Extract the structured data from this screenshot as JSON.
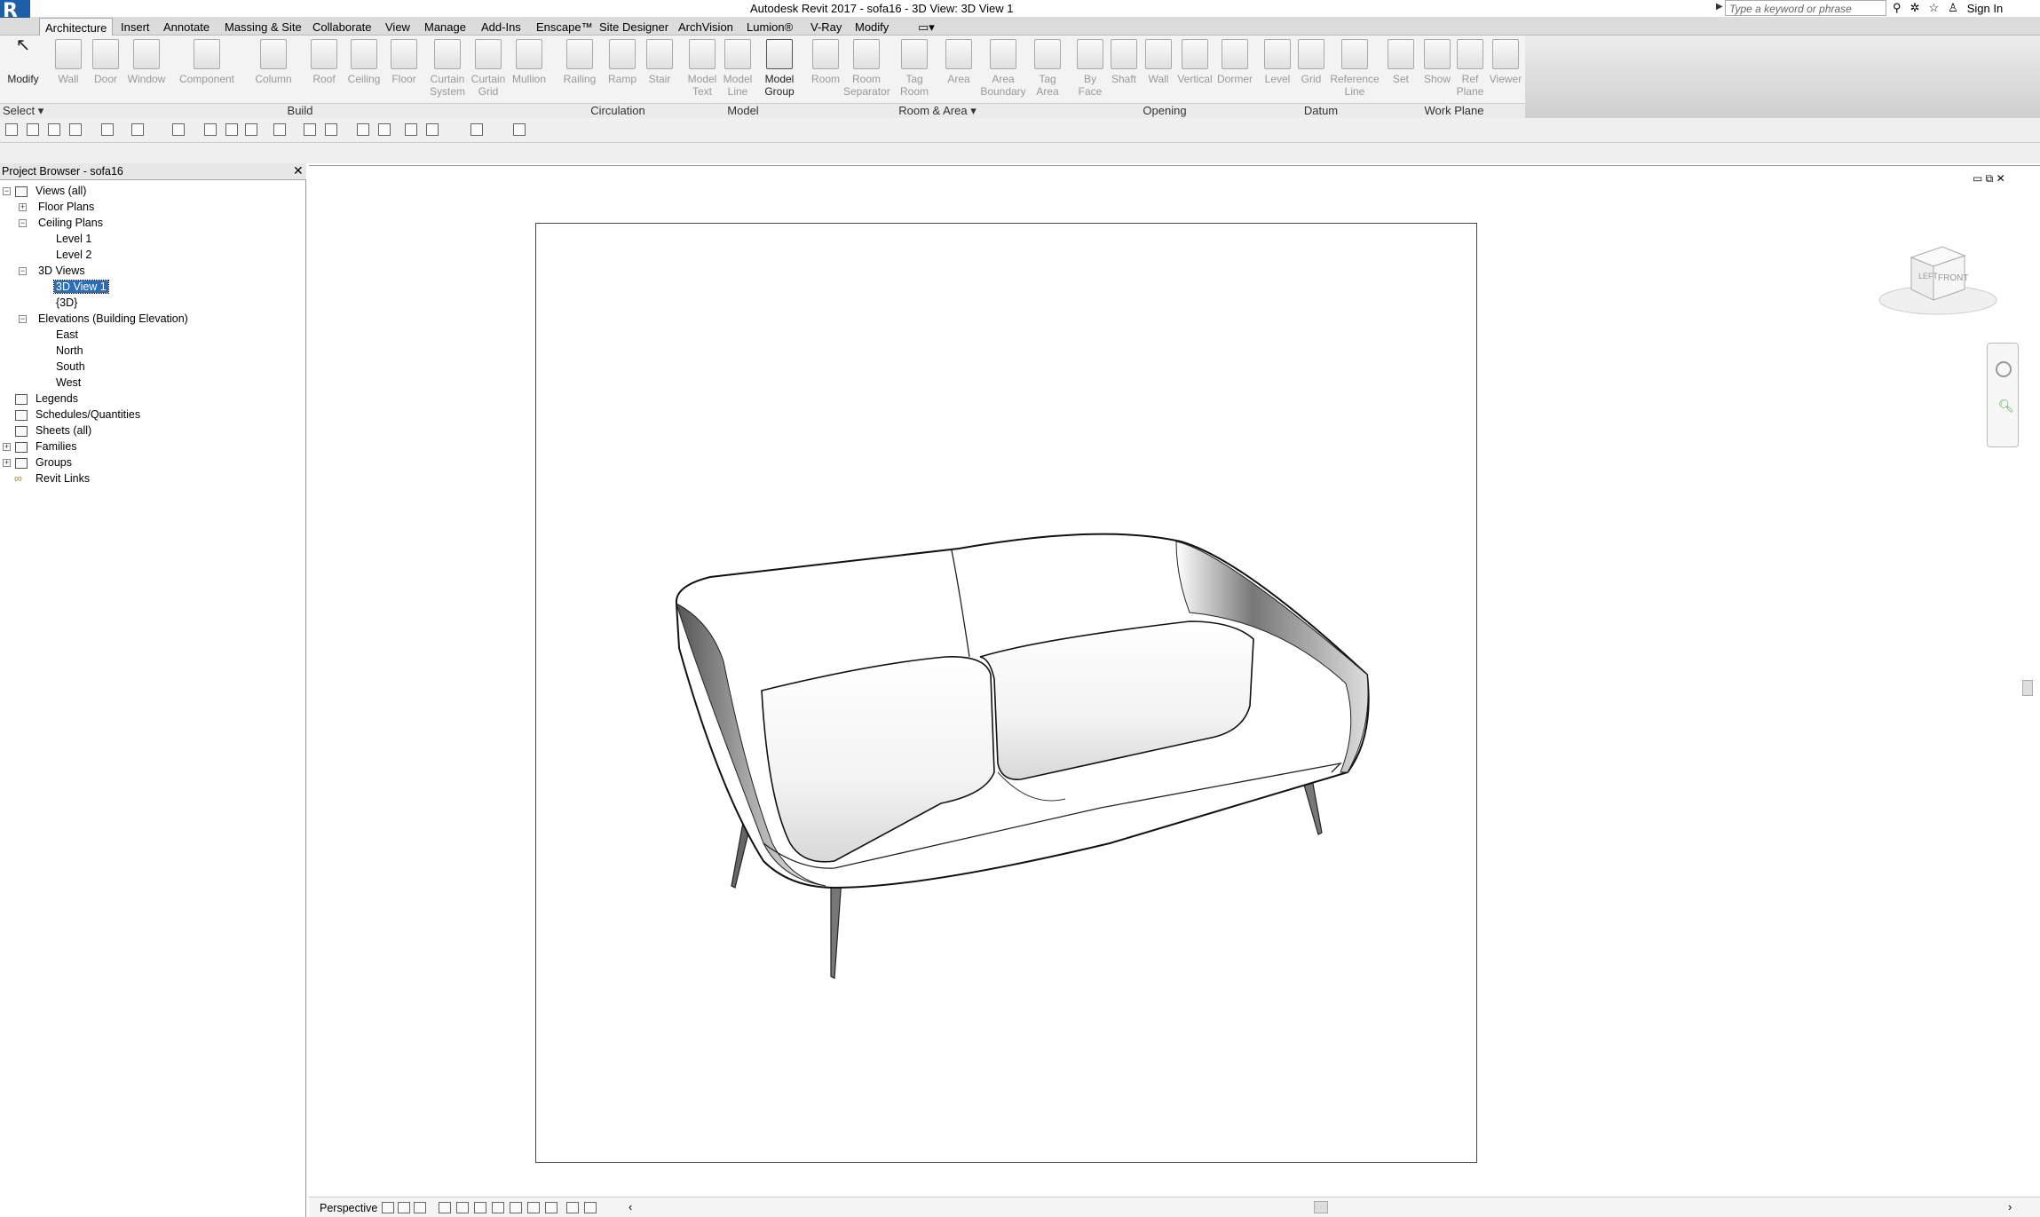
{
  "app": {
    "logo": "R",
    "title": "Autodesk Revit 2017 -      sofa16 - 3D View: 3D View 1",
    "search_placeholder": "Type a keyword or phrase",
    "sign_in": "Sign In"
  },
  "tabs": [
    "Architecture",
    "Insert",
    "Annotate",
    "Massing & Site",
    "Collaborate",
    "View",
    "Manage",
    "Add-Ins",
    "Enscape™",
    "Site Designer",
    "ArchVision",
    "Lumion®",
    "V-Ray",
    "Modify"
  ],
  "ribbon": {
    "modify": "Modify",
    "select": "Select",
    "build": [
      "Wall",
      "Door",
      "Window",
      "Component",
      "Column",
      "Roof",
      "Ceiling",
      "Floor",
      "Curtain System",
      "Curtain Grid",
      "Mullion"
    ],
    "circulation": [
      "Railing",
      "Ramp",
      "Stair"
    ],
    "model": [
      "Model Text",
      "Model Line",
      "Model Group"
    ],
    "room_area": [
      "Room",
      "Room Separator",
      "Tag Room",
      "Area",
      "Area Boundary",
      "Tag Area"
    ],
    "opening": [
      "By Face",
      "Shaft",
      "Wall",
      "Vertical",
      "Dormer"
    ],
    "datum": [
      "Level",
      "Grid",
      "Reference Line"
    ],
    "work_plane": [
      "Set",
      "Show",
      "Ref Plane",
      "Viewer"
    ],
    "panels": {
      "build": "Build",
      "circulation": "Circulation",
      "model": "Model",
      "room_area": "Room & Area",
      "opening": "Opening",
      "datum": "Datum",
      "work_plane": "Work Plane"
    }
  },
  "browser": {
    "title": "Project Browser - sofa16",
    "close": "✕",
    "tree": {
      "views_all": "Views (all)",
      "floor_plans": "Floor Plans",
      "ceiling_plans": "Ceiling Plans",
      "level1": "Level 1",
      "level2": "Level 2",
      "views_3d": "3D Views",
      "view1": "3D View 1",
      "view3d": "{3D}",
      "elevations": "Elevations (Building Elevation)",
      "east": "East",
      "north": "North",
      "south": "South",
      "west": "West",
      "legends": "Legends",
      "schedules": "Schedules/Quantities",
      "sheets": "Sheets (all)",
      "families": "Families",
      "groups": "Groups",
      "links": "Revit Links"
    }
  },
  "viewcube": {
    "left": "LEFT",
    "front": "FRONT"
  },
  "status": {
    "view_mode": "Perspective"
  },
  "colors": {
    "accent": "#2a6ebb",
    "logo": "#1d5fa8"
  },
  "icons": [
    "search-icon",
    "star-icon",
    "user-icon",
    "close-icon",
    "view-cube",
    "navigation-bar"
  ]
}
